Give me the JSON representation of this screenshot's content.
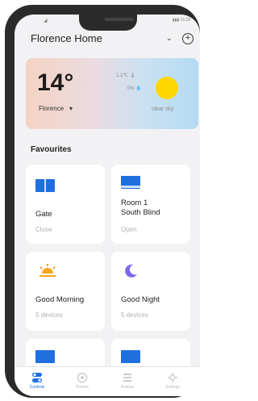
{
  "status_bar": {
    "left": "◢",
    "right": "▮▮▮ 15:28"
  },
  "header": {
    "home_name": "Florence Home",
    "chevron": "⌄",
    "add_symbol": "+"
  },
  "weather": {
    "temperature": "14°",
    "city": "Florence",
    "city_arrow": "▾",
    "humidity_line": "1.1℃ 🌡",
    "rain_line": "0% 💧",
    "condition": "clear sky"
  },
  "favourites": {
    "title": "Favourites",
    "cards": [
      {
        "name": "Gate",
        "status": "Close",
        "icon": "blind-icon"
      },
      {
        "name": "Room 1\nSouth Blind",
        "status": "Open",
        "icon": "blind-icon"
      },
      {
        "name": "Good Morning",
        "status": "5 devices",
        "icon": "sunrise-icon"
      },
      {
        "name": "Good Night",
        "status": "5 devices",
        "icon": "moon-icon"
      },
      {
        "name": "",
        "status": "",
        "icon": "blind-icon"
      },
      {
        "name": "",
        "status": "",
        "icon": "blind-icon"
      }
    ]
  },
  "tabs": [
    {
      "label": "Controls",
      "icon": "toggle-icon",
      "active": true
    },
    {
      "label": "Rooms",
      "icon": "room-icon",
      "active": false
    },
    {
      "label": "Actions",
      "icon": "list-icon",
      "active": false
    },
    {
      "label": "Settings",
      "icon": "gear-icon",
      "active": false
    }
  ],
  "colors": {
    "accent": "#1f6fe0",
    "sun": "#ffd700",
    "moon": "#7b68ee",
    "sunrise": "#f5a623"
  }
}
